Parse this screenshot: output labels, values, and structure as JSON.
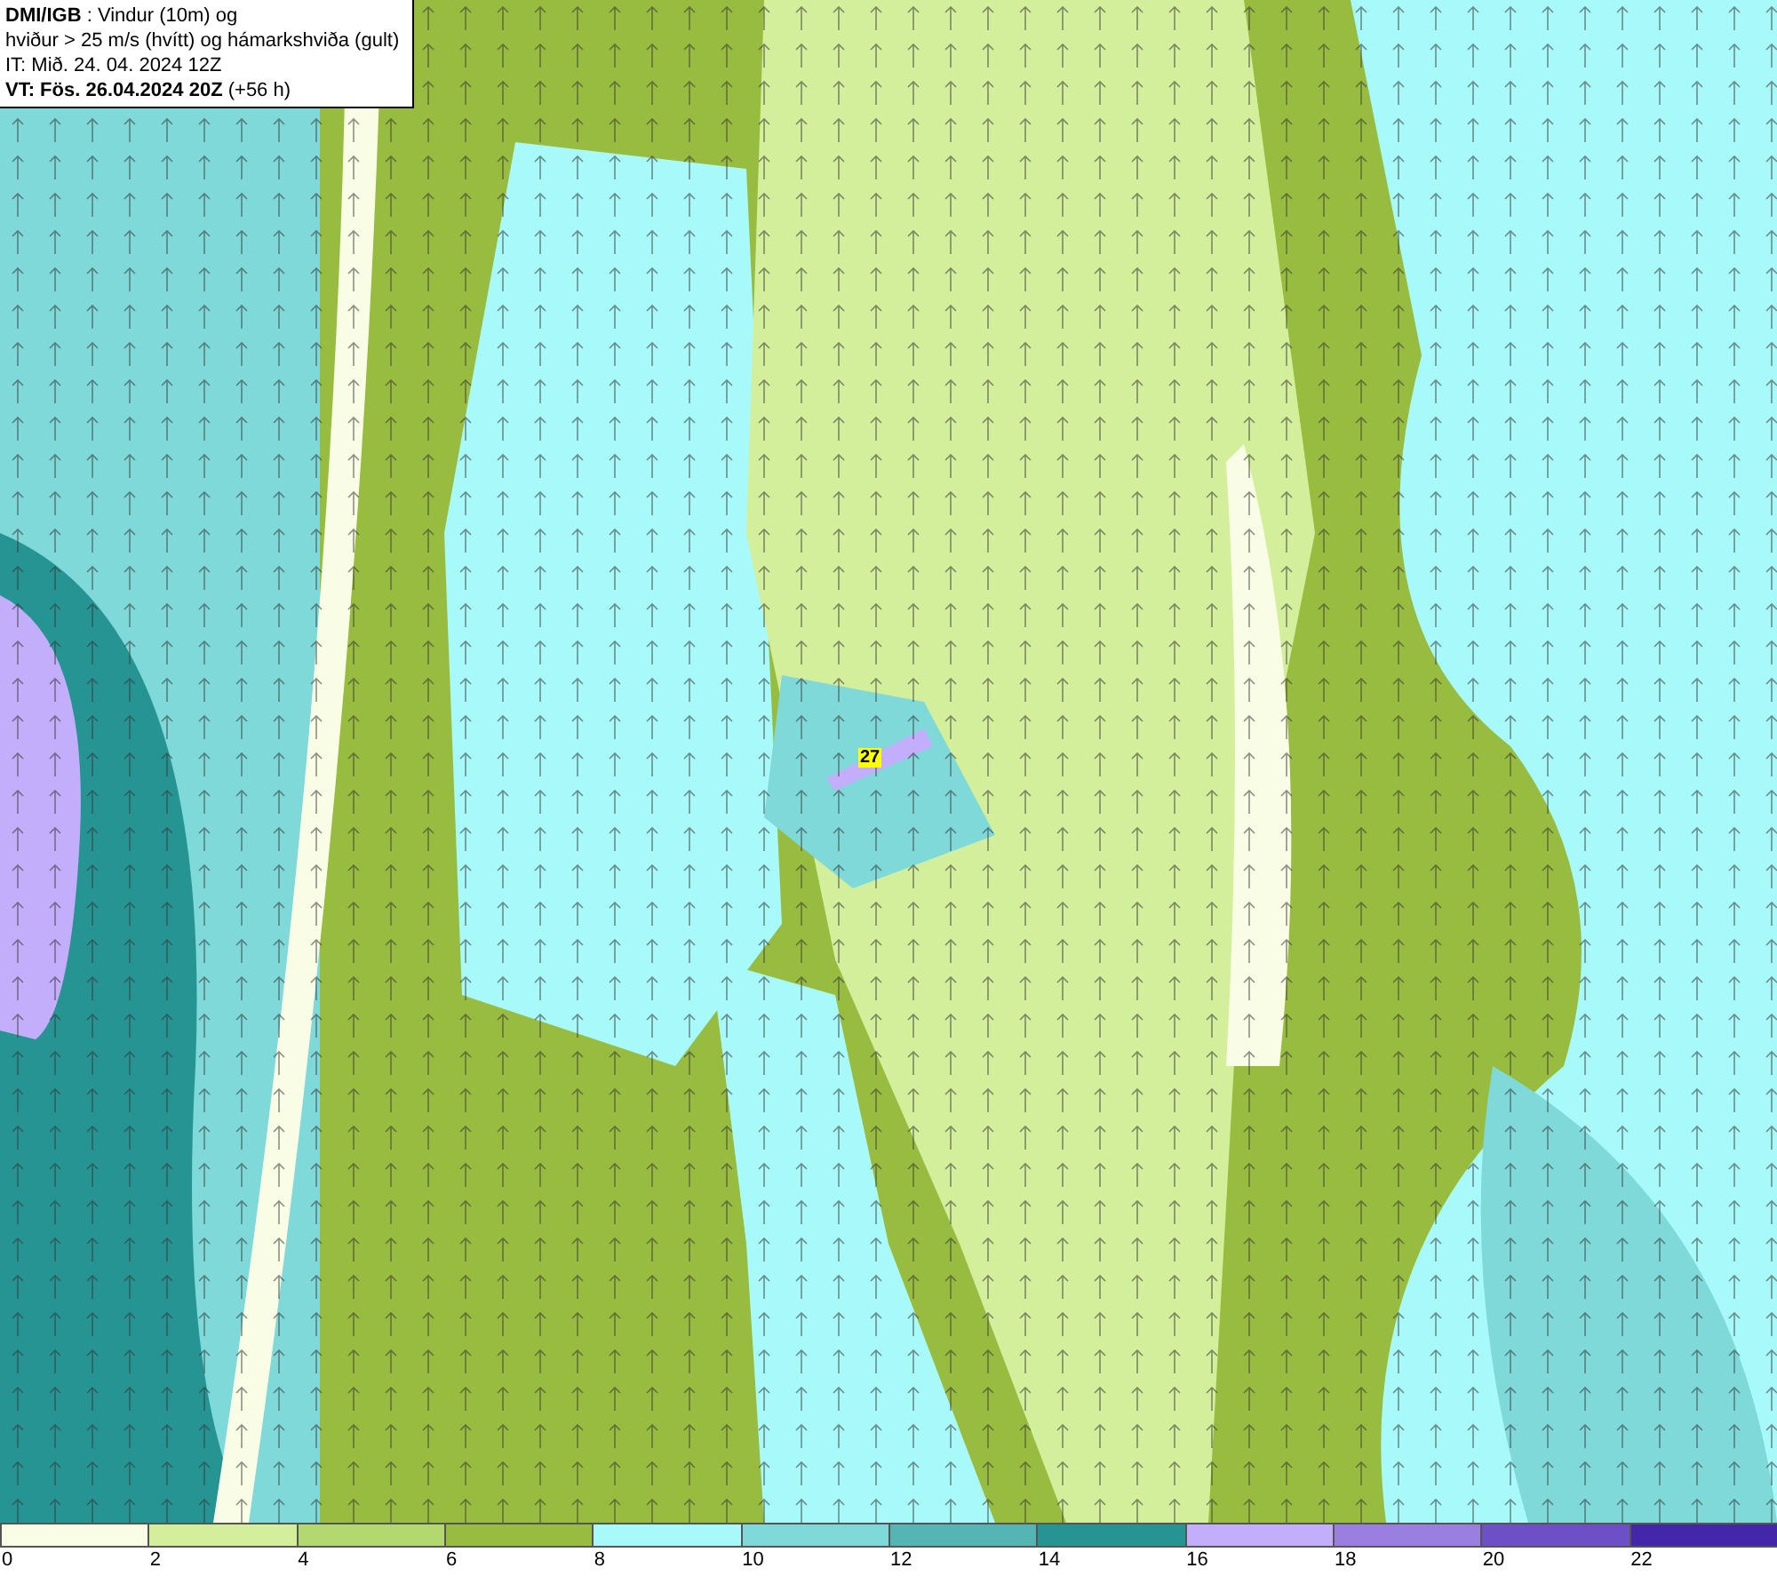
{
  "info_box": {
    "lines": [
      "**DMI/IGB** : Vindur (10m) og",
      "hviður > 25 m/s (hvítt) og hámarkshviða (gult)",
      "IT: Mið. 24. 04. 2024 12Z",
      "**VT: Fös. 26.04.2024 20Z** (+56 h)"
    ]
  },
  "map": {
    "max_gust_label": "27"
  },
  "legend": [
    {
      "label": "0",
      "color": "#fafde6"
    },
    {
      "label": "2",
      "color": "#d4ef9c"
    },
    {
      "label": "4",
      "color": "#b4d870"
    },
    {
      "label": "6",
      "color": "#98bc40"
    },
    {
      "label": "8",
      "color": "#a8fafa"
    },
    {
      "label": "10",
      "color": "#7fd9d9"
    },
    {
      "label": "12",
      "color": "#55b5b5"
    },
    {
      "label": "14",
      "color": "#279494"
    },
    {
      "label": "16",
      "color": "#c2aefa"
    },
    {
      "label": "18",
      "color": "#9a7ee0"
    },
    {
      "label": "20",
      "color": "#6e50c6"
    },
    {
      "label": "22",
      "color": "#4228a8"
    }
  ]
}
